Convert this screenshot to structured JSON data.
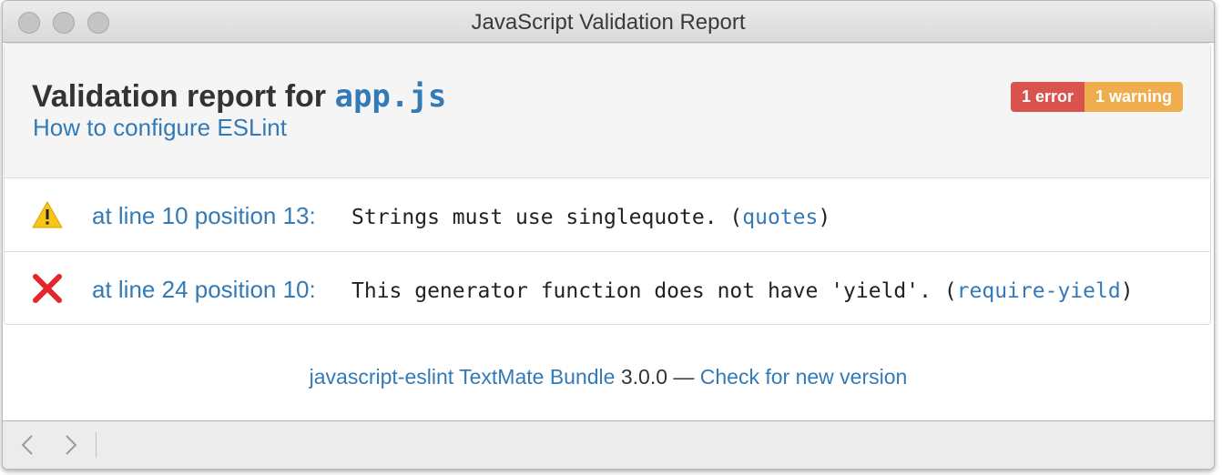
{
  "window": {
    "title": "JavaScript Validation Report"
  },
  "header": {
    "title_prefix": "Validation report for ",
    "filename": "app.js",
    "config_link": "How to configure ESLint",
    "badges": {
      "error": "1 error",
      "warning": "1 warning"
    }
  },
  "results": [
    {
      "type": "warning",
      "icon": "warning-icon",
      "location": "at line 10 position 13:",
      "message": "Strings must use singlequote. (",
      "rule": "quotes",
      "close": ")"
    },
    {
      "type": "error",
      "icon": "error-icon",
      "location": "at line 24 position 10:",
      "message": "This generator function does not have 'yield'. (",
      "rule": "require-yield",
      "close": ")"
    }
  ],
  "footer": {
    "bundle_link": "javascript-eslint TextMate Bundle",
    "version": " 3.0.0 — ",
    "update_link": "Check for new version"
  },
  "colors": {
    "link": "#337ab7",
    "error": "#d9534f",
    "warning": "#f0ad4e"
  }
}
